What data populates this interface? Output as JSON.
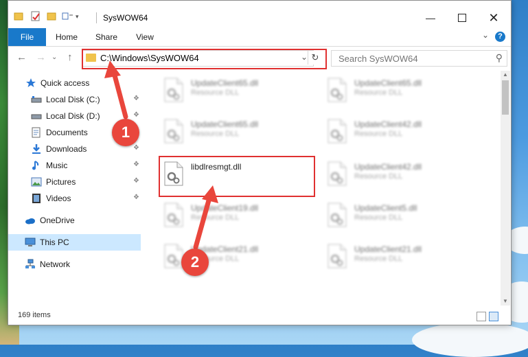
{
  "window": {
    "title": "SysWOW64"
  },
  "ribbon": {
    "tabs": [
      {
        "label": "File"
      },
      {
        "label": "Home"
      },
      {
        "label": "Share"
      },
      {
        "label": "View"
      }
    ],
    "help": "?"
  },
  "navbar": {
    "address": "C:\\Windows\\SysWOW64",
    "search_placeholder": "Search SysWOW64"
  },
  "sidebar": {
    "items": [
      {
        "label": "Quick access",
        "icon": "star-icon"
      },
      {
        "label": "Local Disk (C:)",
        "icon": "drive-icon",
        "pinned": true
      },
      {
        "label": "Local Disk (D:)",
        "icon": "drive-icon",
        "pinned": true
      },
      {
        "label": "Documents",
        "icon": "documents-icon",
        "pinned": true
      },
      {
        "label": "Downloads",
        "icon": "download-icon",
        "pinned": true
      },
      {
        "label": "Music",
        "icon": "music-icon",
        "pinned": true
      },
      {
        "label": "Pictures",
        "icon": "pictures-icon",
        "pinned": true
      },
      {
        "label": "Videos",
        "icon": "videos-icon",
        "pinned": true
      },
      {
        "label": "OneDrive",
        "icon": "cloud-icon"
      },
      {
        "label": "This PC",
        "icon": "computer-icon",
        "selected": true
      },
      {
        "label": "Network",
        "icon": "network-icon"
      }
    ]
  },
  "files": {
    "left": [
      {
        "name": "UpdateClient65.dll",
        "type": "Resource DLL",
        "blurred": true
      },
      {
        "name": "UpdateClient65.dll",
        "type": "Resource DLL",
        "blurred": true
      },
      {
        "name": "libdlresmgt.dll",
        "type": "",
        "blurred": false
      },
      {
        "name": "UpdateClient19.dll",
        "type": "Resource DLL",
        "blurred": true
      },
      {
        "name": "UpdateClient21.dll",
        "type": "Resource DLL",
        "blurred": true
      }
    ],
    "right": [
      {
        "name": "UpdateClient65.dll",
        "type": "Resource DLL",
        "blurred": true
      },
      {
        "name": "UpdateClient42.dll",
        "type": "Resource DLL",
        "blurred": true
      },
      {
        "name": "UpdateClient42.dll",
        "type": "Resource DLL",
        "blurred": true
      },
      {
        "name": "UpdateClient5.dll",
        "type": "Resource DLL",
        "blurred": true
      },
      {
        "name": "UpdateClient21.dll",
        "type": "Resource DLL",
        "blurred": true
      }
    ]
  },
  "status": {
    "item_count": "169 items"
  },
  "annotations": {
    "step1": "1",
    "step2": "2",
    "color": "#e9463c"
  },
  "colors": {
    "accent": "#1979ca",
    "selected_bg": "#cce8ff",
    "highlight_box": "#e03030"
  }
}
